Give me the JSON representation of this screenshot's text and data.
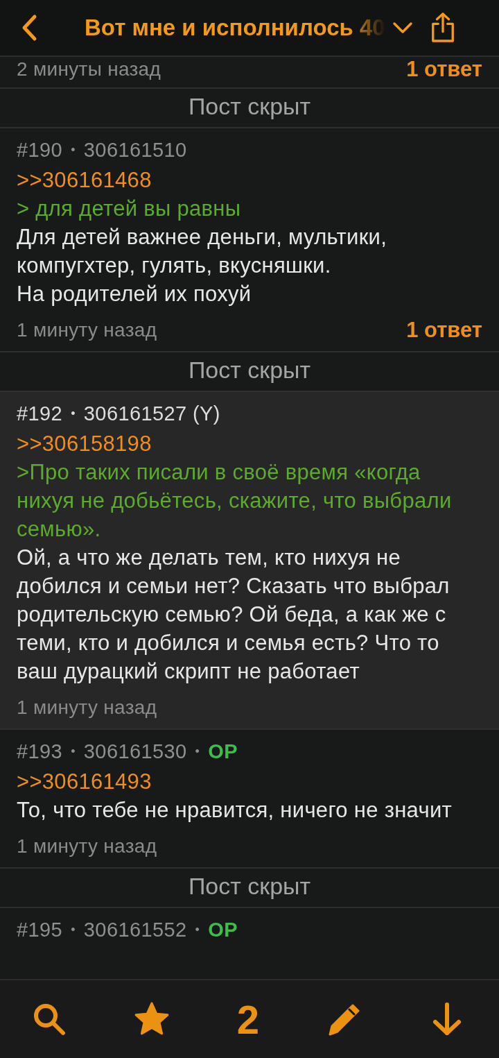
{
  "header": {
    "title": "Вот мне и исполнилось 40"
  },
  "posts": [
    {
      "kind": "post",
      "time": "2 минуты назад",
      "replies": "1 ответ",
      "highlighted": false
    },
    {
      "kind": "hidden",
      "label": "Пост скрыт"
    },
    {
      "kind": "post",
      "meta": [
        {
          "kind": "number",
          "text": "#190"
        },
        {
          "kind": "dot",
          "text": "•"
        },
        {
          "kind": "id",
          "text": "306161510"
        }
      ],
      "time": "1 минуту назад",
      "replies": "1 ответ",
      "highlighted": false,
      "lines": [
        {
          "kind": "link",
          "text": ">>306161468"
        },
        {
          "kind": "quote",
          "text": "> для детей вы равны"
        },
        {
          "kind": "text",
          "text": "Для детей важнее деньги, мультики, компугхтер, гулять, вкусняшки."
        },
        {
          "kind": "text",
          "text": "На родителей их похуй"
        }
      ]
    },
    {
      "kind": "hidden",
      "label": "Пост скрыт"
    },
    {
      "kind": "post",
      "meta": [
        {
          "kind": "number",
          "text": "#192"
        },
        {
          "kind": "dot",
          "text": "•"
        },
        {
          "kind": "id",
          "text": "306161527 (Y)"
        }
      ],
      "time": "1 минуту назад",
      "highlighted": true,
      "lines": [
        {
          "kind": "link",
          "text": ">>306158198"
        },
        {
          "kind": "quote",
          "text": ">Про таких писали в своё время «когда нихуя не добьётесь, скажите, что выбрали семью»."
        },
        {
          "kind": "text",
          "text": "Ой, а что же делать тем, кто нихуя не добился и семьи нет? Сказать что выбрал родительскую семью? Ой беда, а как же с теми, кто и добился и семья есть? Что то ваш дурацкий скрипт не работает"
        }
      ]
    },
    {
      "kind": "post",
      "meta": [
        {
          "kind": "number",
          "text": "#193"
        },
        {
          "kind": "dot",
          "text": "•"
        },
        {
          "kind": "id",
          "text": "306161530"
        },
        {
          "kind": "dot",
          "text": "•"
        },
        {
          "kind": "op",
          "text": "OP"
        }
      ],
      "time": "1 минуту назад",
      "highlighted": false,
      "lines": [
        {
          "kind": "link",
          "text": ">>306161493"
        },
        {
          "kind": "text",
          "text": "То, что тебе не нравится, ничего не значит"
        }
      ]
    },
    {
      "kind": "hidden",
      "label": "Пост скрыт"
    },
    {
      "kind": "post",
      "meta": [
        {
          "kind": "number",
          "text": "#195"
        },
        {
          "kind": "dot",
          "text": "•"
        },
        {
          "kind": "id",
          "text": "306161552"
        },
        {
          "kind": "dot",
          "text": "•"
        },
        {
          "kind": "op",
          "text": "OP"
        }
      ],
      "highlighted": false
    }
  ],
  "toolbar": {
    "counter": "2"
  }
}
